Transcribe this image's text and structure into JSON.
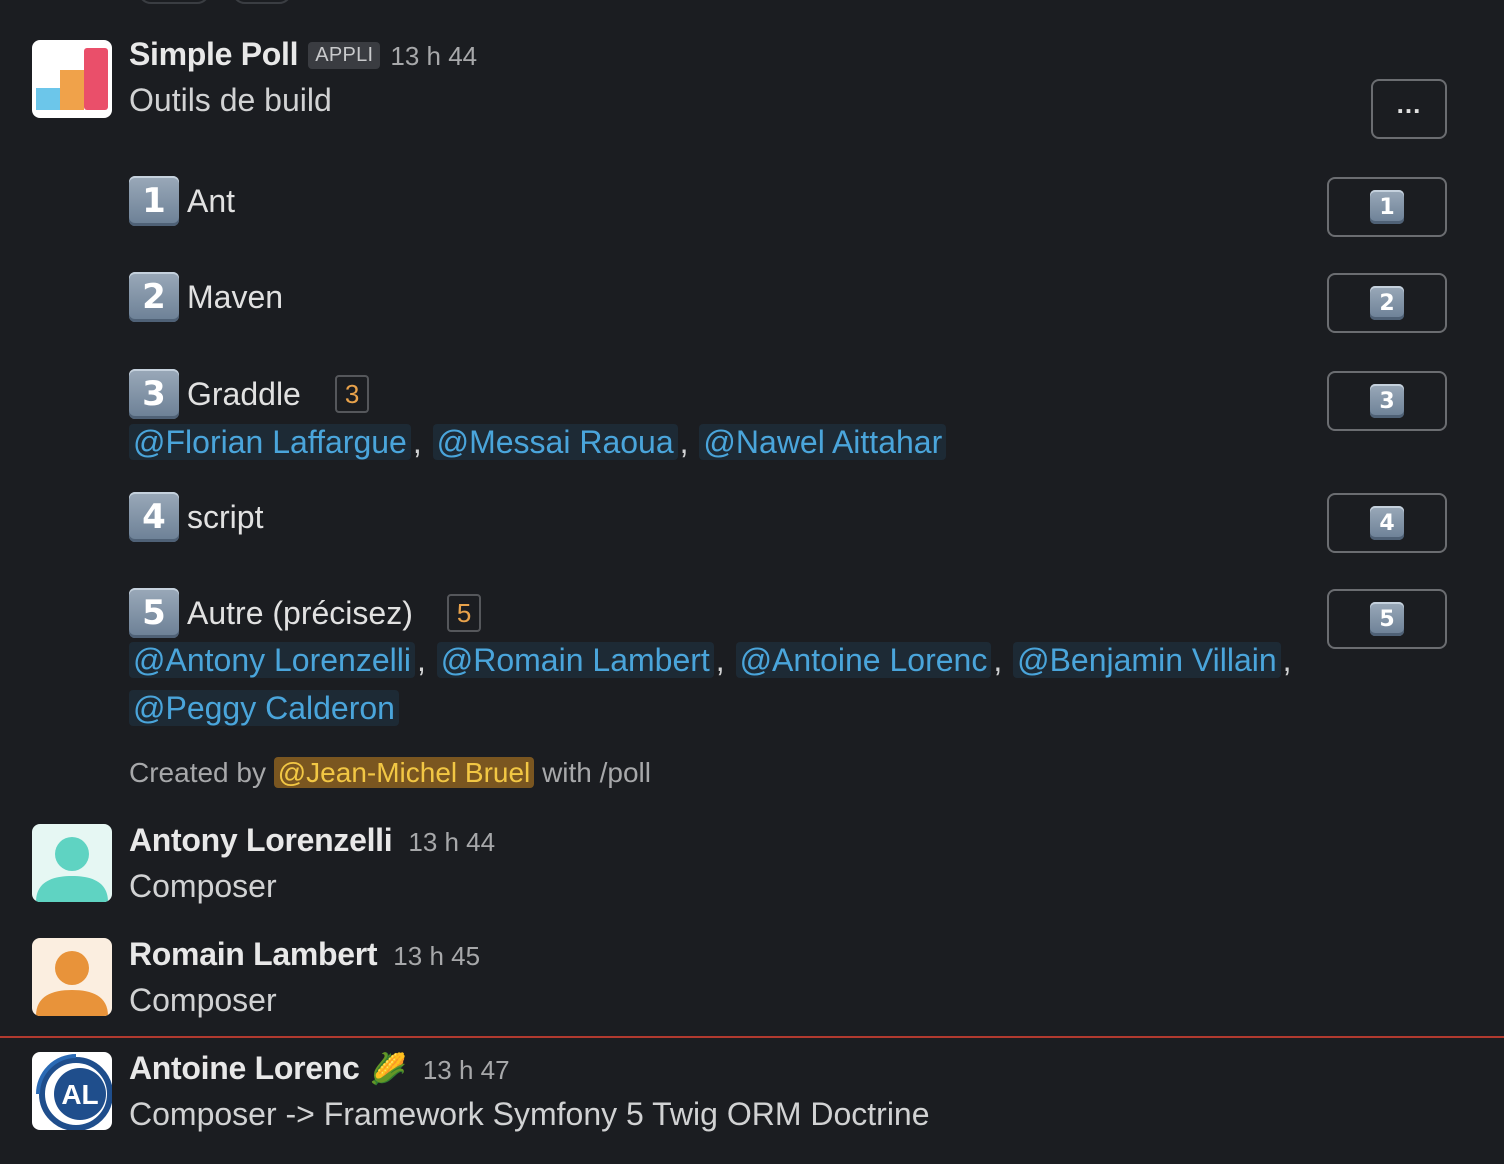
{
  "poll_message": {
    "author": "Simple Poll",
    "badge": "APPLI",
    "time": "13 h 44",
    "title": "Outils de build",
    "more_label": "...",
    "options": [
      {
        "num": "1",
        "label": "Ant",
        "count": "",
        "voters": []
      },
      {
        "num": "2",
        "label": "Maven",
        "count": "",
        "voters": []
      },
      {
        "num": "3",
        "label": "Graddle",
        "count": "3",
        "voters": [
          "@Florian Laffargue",
          "@Messai Raoua",
          "@Nawel Aittahar"
        ]
      },
      {
        "num": "4",
        "label": "script",
        "count": "",
        "voters": []
      },
      {
        "num": "5",
        "label": "Autre (précisez)",
        "count": "5",
        "voters": [
          "@Antony Lorenzelli",
          "@Romain Lambert",
          "@Antoine Lorenc",
          "@Benjamin Villain",
          "@Peggy Calderon"
        ]
      }
    ],
    "created_prefix": "Created by",
    "created_user": "@Jean-Michel Bruel",
    "created_suffix": "with /poll"
  },
  "messages": [
    {
      "author": "Antony Lorenzelli",
      "time": "13 h 44",
      "text": "Composer",
      "avatar_color": "#5fd3c2",
      "avatar_bg": "#e6f7f3"
    },
    {
      "author": "Romain Lambert",
      "time": "13 h 45",
      "text": "Composer",
      "avatar_color": "#e8933a",
      "avatar_bg": "#fbeee0"
    },
    {
      "author": "Antoine Lorenc",
      "status_emoji": "🌽",
      "time": "13 h 47",
      "text": "Composer -> Framework Symfony 5 Twig ORM Doctrine",
      "avatar_text": "AL"
    }
  ],
  "colors": {
    "mention": "#4aa5db",
    "count": "#e8a24b",
    "new_divider": "#b23a2f"
  }
}
